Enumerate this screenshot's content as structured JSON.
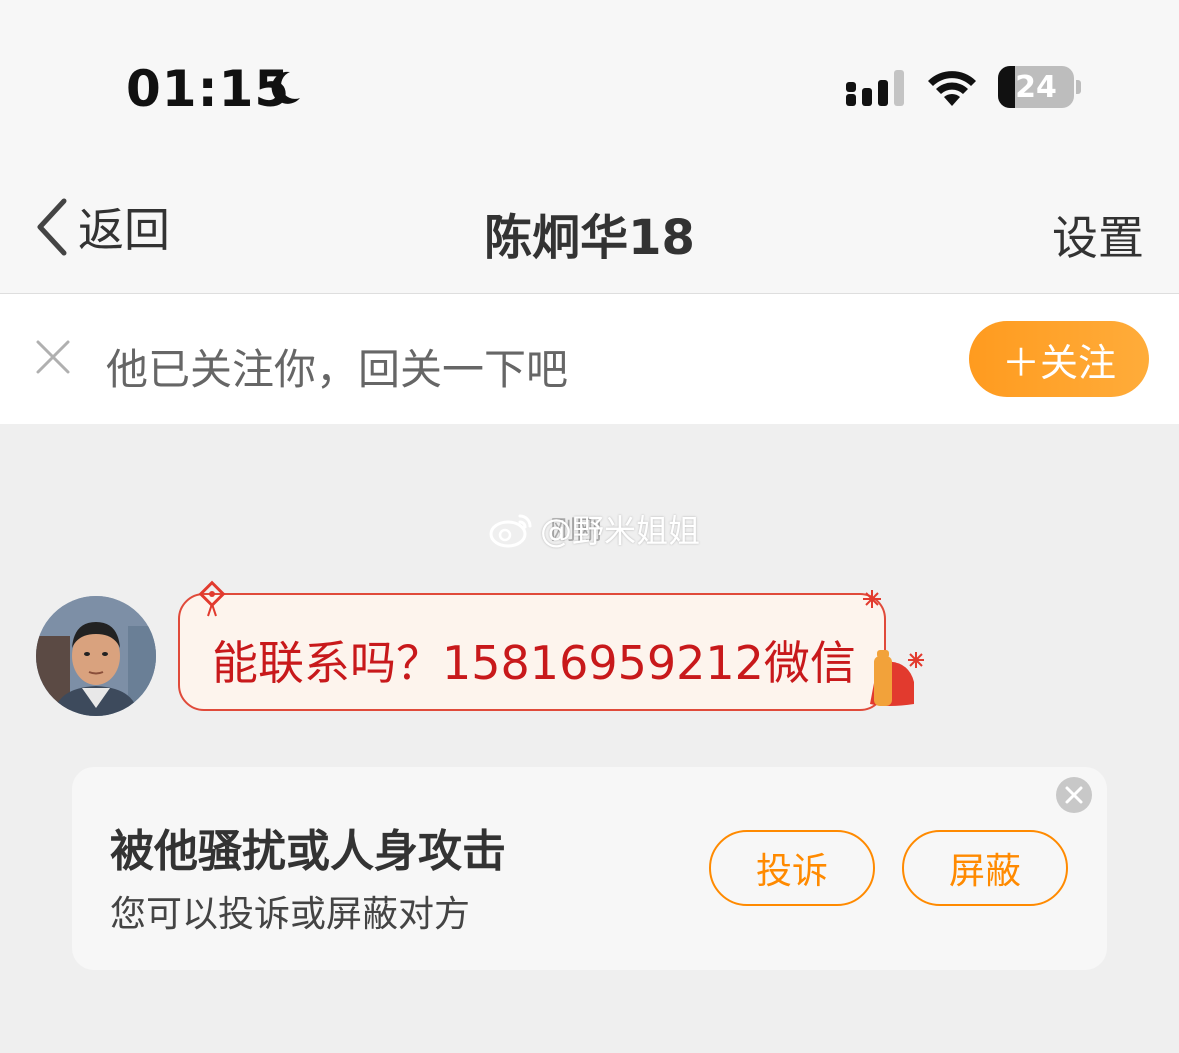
{
  "status_bar": {
    "time": "01:15",
    "battery_level": "24",
    "icons": [
      "moon-icon",
      "cellular-signal-icon",
      "wifi-icon",
      "battery-icon"
    ]
  },
  "nav": {
    "back_label": "返回",
    "title": "陈炯华18",
    "settings_label": "设置"
  },
  "follow_banner": {
    "text": "他已关注你，回关一下吧",
    "follow_button_label": "＋关注"
  },
  "chat": {
    "timestamp": "刚刚",
    "watermark": "@野米姐姐",
    "messages": [
      {
        "from": "other",
        "text": "能联系吗？15816959212微信"
      }
    ]
  },
  "report_card": {
    "title": "被他骚扰或人身攻击",
    "subtitle": "您可以投诉或屏蔽对方",
    "report_label": "投诉",
    "block_label": "屏蔽"
  },
  "colors": {
    "accent_orange": "#ff8a00",
    "message_red": "#c8191b",
    "background": "#efefef"
  }
}
